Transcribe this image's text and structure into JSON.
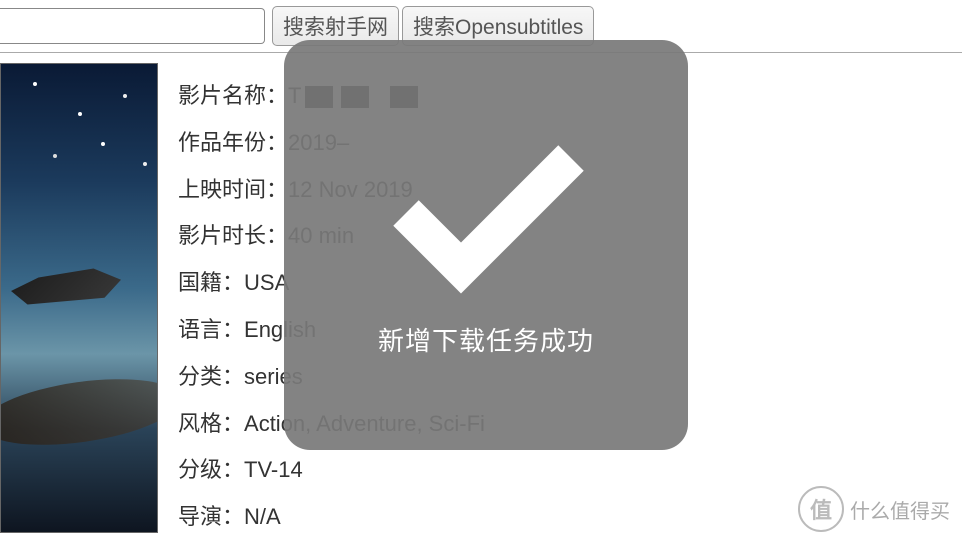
{
  "search": {
    "input_value": "",
    "btn_shooter": "搜索射手网",
    "btn_opensubtitles": "搜索Opensubtitles"
  },
  "details": {
    "title_label": "影片名称：",
    "title_value_prefix": "T",
    "year_label": "作品年份：",
    "year_value": "2019–",
    "release_label": "上映时间：",
    "release_value": "12 Nov 2019",
    "runtime_label": "影片时长：",
    "runtime_value": "40 min",
    "country_label": "国籍：",
    "country_value": "USA",
    "language_label": "语言：",
    "language_value": "English",
    "type_label": "分类：",
    "type_value": "series",
    "genre_label": "风格：",
    "genre_value": "Action, Adventure, Sci-Fi",
    "rating_label": "分级：",
    "rating_value": "TV-14",
    "director_label": "导演：",
    "director_value": "N/A"
  },
  "toast": {
    "message": "新增下载任务成功"
  },
  "watermark": {
    "symbol": "值",
    "text": "什么值得买"
  }
}
